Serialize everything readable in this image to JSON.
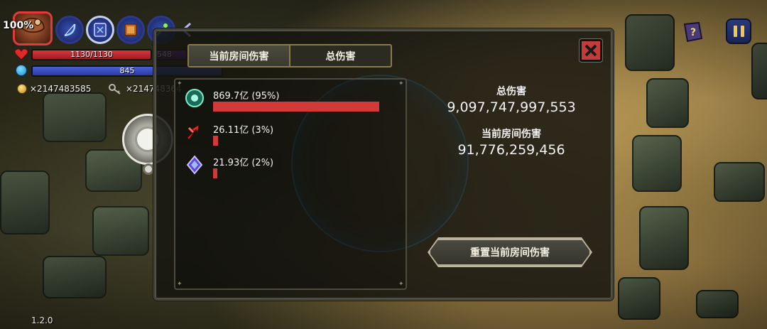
{
  "hud": {
    "health_percent_label": "100%",
    "health_text": "1130/1130",
    "shield_text": "548",
    "mana_text": "845",
    "gold_count": "×2147483585",
    "key_count": "×2147483647",
    "version": "1.2.0",
    "skills": [
      {
        "icon": "bow-icon"
      },
      {
        "icon": "spellbook-icon"
      },
      {
        "icon": "tome-icon"
      },
      {
        "icon": "staff-icon"
      }
    ]
  },
  "panel": {
    "tabs": [
      {
        "label": "当前房间伤害",
        "active": true
      },
      {
        "label": "总伤害",
        "active": false
      }
    ],
    "damage_sources": [
      {
        "label": "869.7亿 (95%)",
        "percent": 95,
        "icon": "green-orb-icon"
      },
      {
        "label": "26.11亿 (3%)",
        "percent": 3,
        "icon": "red-arrows-icon"
      },
      {
        "label": "21.93亿 (2%)",
        "percent": 2,
        "icon": "purple-crystal-icon"
      }
    ],
    "total_damage_label": "总伤害",
    "total_damage_value": "9,097,747,997,553",
    "room_damage_label": "当前房间伤害",
    "room_damage_value": "91,776,259,456",
    "reset_button_label": "重置当前房间伤害"
  },
  "colors": {
    "damage_bar": "#d23a3a",
    "close_button": "#c53a3a",
    "health": "#d8363c",
    "mana": "#4860d6"
  }
}
